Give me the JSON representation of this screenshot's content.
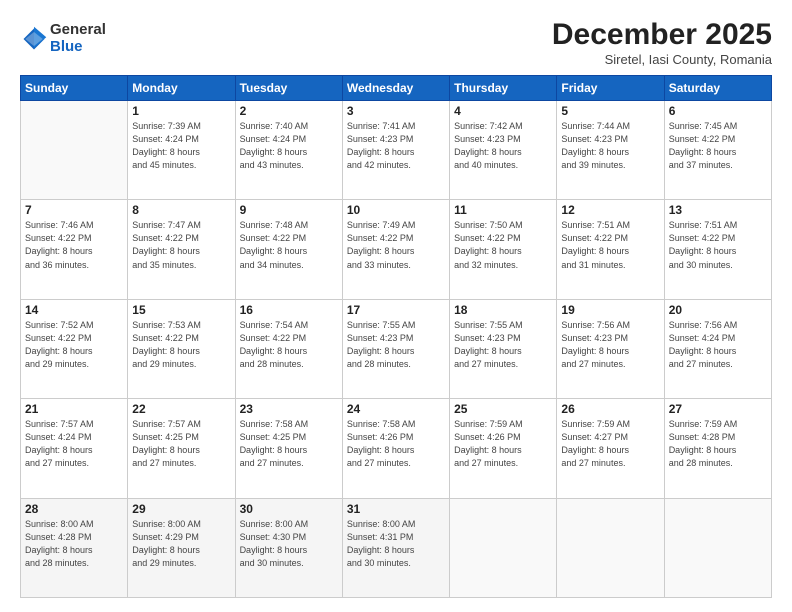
{
  "logo": {
    "general": "General",
    "blue": "Blue"
  },
  "title": "December 2025",
  "location": "Siretel, Iasi County, Romania",
  "weekdays": [
    "Sunday",
    "Monday",
    "Tuesday",
    "Wednesday",
    "Thursday",
    "Friday",
    "Saturday"
  ],
  "weeks": [
    [
      {
        "day": "",
        "info": ""
      },
      {
        "day": "1",
        "info": "Sunrise: 7:39 AM\nSunset: 4:24 PM\nDaylight: 8 hours\nand 45 minutes."
      },
      {
        "day": "2",
        "info": "Sunrise: 7:40 AM\nSunset: 4:24 PM\nDaylight: 8 hours\nand 43 minutes."
      },
      {
        "day": "3",
        "info": "Sunrise: 7:41 AM\nSunset: 4:23 PM\nDaylight: 8 hours\nand 42 minutes."
      },
      {
        "day": "4",
        "info": "Sunrise: 7:42 AM\nSunset: 4:23 PM\nDaylight: 8 hours\nand 40 minutes."
      },
      {
        "day": "5",
        "info": "Sunrise: 7:44 AM\nSunset: 4:23 PM\nDaylight: 8 hours\nand 39 minutes."
      },
      {
        "day": "6",
        "info": "Sunrise: 7:45 AM\nSunset: 4:22 PM\nDaylight: 8 hours\nand 37 minutes."
      }
    ],
    [
      {
        "day": "7",
        "info": "Sunrise: 7:46 AM\nSunset: 4:22 PM\nDaylight: 8 hours\nand 36 minutes."
      },
      {
        "day": "8",
        "info": "Sunrise: 7:47 AM\nSunset: 4:22 PM\nDaylight: 8 hours\nand 35 minutes."
      },
      {
        "day": "9",
        "info": "Sunrise: 7:48 AM\nSunset: 4:22 PM\nDaylight: 8 hours\nand 34 minutes."
      },
      {
        "day": "10",
        "info": "Sunrise: 7:49 AM\nSunset: 4:22 PM\nDaylight: 8 hours\nand 33 minutes."
      },
      {
        "day": "11",
        "info": "Sunrise: 7:50 AM\nSunset: 4:22 PM\nDaylight: 8 hours\nand 32 minutes."
      },
      {
        "day": "12",
        "info": "Sunrise: 7:51 AM\nSunset: 4:22 PM\nDaylight: 8 hours\nand 31 minutes."
      },
      {
        "day": "13",
        "info": "Sunrise: 7:51 AM\nSunset: 4:22 PM\nDaylight: 8 hours\nand 30 minutes."
      }
    ],
    [
      {
        "day": "14",
        "info": "Sunrise: 7:52 AM\nSunset: 4:22 PM\nDaylight: 8 hours\nand 29 minutes."
      },
      {
        "day": "15",
        "info": "Sunrise: 7:53 AM\nSunset: 4:22 PM\nDaylight: 8 hours\nand 29 minutes."
      },
      {
        "day": "16",
        "info": "Sunrise: 7:54 AM\nSunset: 4:22 PM\nDaylight: 8 hours\nand 28 minutes."
      },
      {
        "day": "17",
        "info": "Sunrise: 7:55 AM\nSunset: 4:23 PM\nDaylight: 8 hours\nand 28 minutes."
      },
      {
        "day": "18",
        "info": "Sunrise: 7:55 AM\nSunset: 4:23 PM\nDaylight: 8 hours\nand 27 minutes."
      },
      {
        "day": "19",
        "info": "Sunrise: 7:56 AM\nSunset: 4:23 PM\nDaylight: 8 hours\nand 27 minutes."
      },
      {
        "day": "20",
        "info": "Sunrise: 7:56 AM\nSunset: 4:24 PM\nDaylight: 8 hours\nand 27 minutes."
      }
    ],
    [
      {
        "day": "21",
        "info": "Sunrise: 7:57 AM\nSunset: 4:24 PM\nDaylight: 8 hours\nand 27 minutes."
      },
      {
        "day": "22",
        "info": "Sunrise: 7:57 AM\nSunset: 4:25 PM\nDaylight: 8 hours\nand 27 minutes."
      },
      {
        "day": "23",
        "info": "Sunrise: 7:58 AM\nSunset: 4:25 PM\nDaylight: 8 hours\nand 27 minutes."
      },
      {
        "day": "24",
        "info": "Sunrise: 7:58 AM\nSunset: 4:26 PM\nDaylight: 8 hours\nand 27 minutes."
      },
      {
        "day": "25",
        "info": "Sunrise: 7:59 AM\nSunset: 4:26 PM\nDaylight: 8 hours\nand 27 minutes."
      },
      {
        "day": "26",
        "info": "Sunrise: 7:59 AM\nSunset: 4:27 PM\nDaylight: 8 hours\nand 27 minutes."
      },
      {
        "day": "27",
        "info": "Sunrise: 7:59 AM\nSunset: 4:28 PM\nDaylight: 8 hours\nand 28 minutes."
      }
    ],
    [
      {
        "day": "28",
        "info": "Sunrise: 8:00 AM\nSunset: 4:28 PM\nDaylight: 8 hours\nand 28 minutes."
      },
      {
        "day": "29",
        "info": "Sunrise: 8:00 AM\nSunset: 4:29 PM\nDaylight: 8 hours\nand 29 minutes."
      },
      {
        "day": "30",
        "info": "Sunrise: 8:00 AM\nSunset: 4:30 PM\nDaylight: 8 hours\nand 30 minutes."
      },
      {
        "day": "31",
        "info": "Sunrise: 8:00 AM\nSunset: 4:31 PM\nDaylight: 8 hours\nand 30 minutes."
      },
      {
        "day": "",
        "info": ""
      },
      {
        "day": "",
        "info": ""
      },
      {
        "day": "",
        "info": ""
      }
    ]
  ]
}
